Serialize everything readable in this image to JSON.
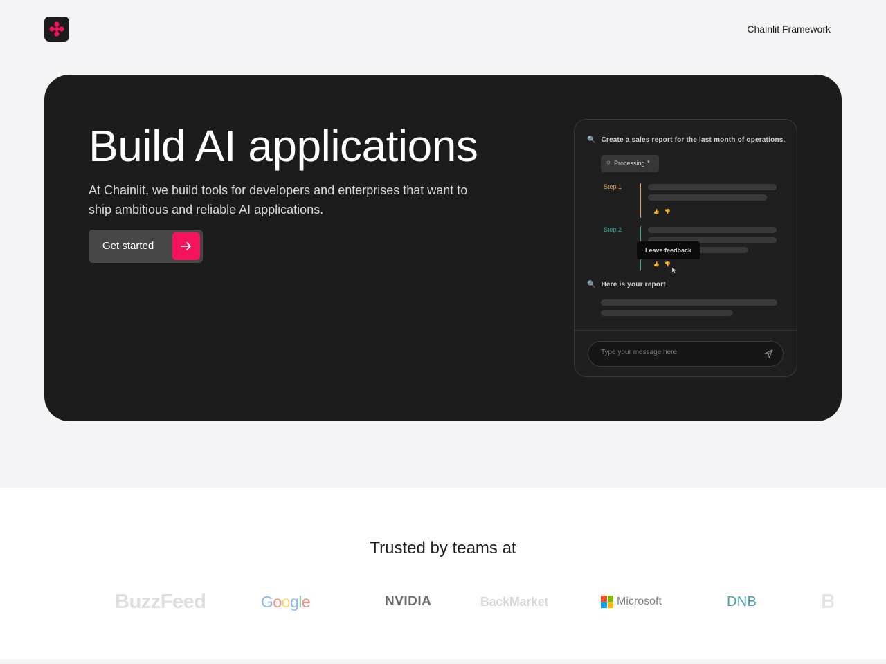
{
  "header": {
    "nav_link": "Chainlit Framework"
  },
  "hero": {
    "title": "Build AI applications",
    "subtitle": "At Chainlit, we build tools for developers and enterprises that want to ship ambitious and reliable AI applications.",
    "cta_label": "Get started",
    "accent_color": "#f5145c"
  },
  "chat_preview": {
    "question": "Create a sales report for the last month of operations.",
    "processing_label": "Processing",
    "steps": [
      {
        "label": "Step 1",
        "color": "#e7a14c"
      },
      {
        "label": "Step 2",
        "color": "#25b5a0"
      }
    ],
    "tooltip": "Leave feedback",
    "answer": "Here is your report",
    "input_placeholder": "Type your message here"
  },
  "trusted": {
    "title": "Trusted by teams at",
    "logos": [
      "BuzzFeed",
      "Google",
      "NVIDIA",
      "BackMarket",
      "Microsoft",
      "DNB",
      "B"
    ]
  }
}
